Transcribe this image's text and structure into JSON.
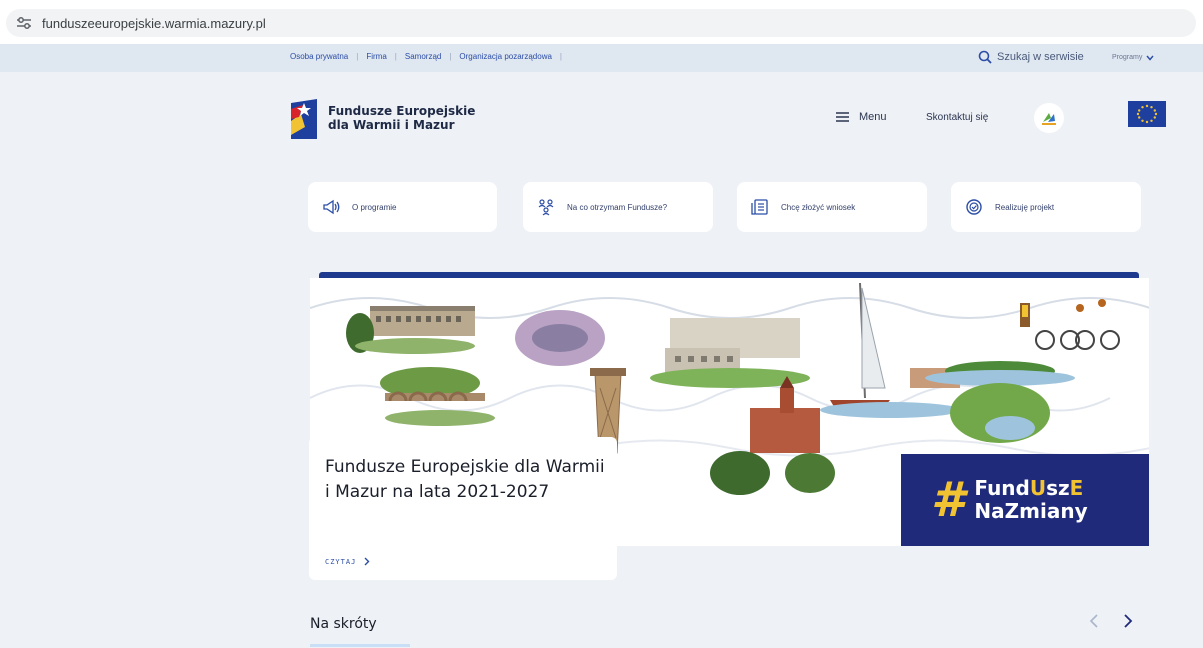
{
  "browser": {
    "url": "funduszeeuropejskie.warmia.mazury.pl"
  },
  "topbar": {
    "audience": [
      "Osoba prywatna",
      "Firma",
      "Samorząd",
      "Organizacja pozarządowa"
    ],
    "search_label": "Szukaj w serwisie",
    "programs_label": "Programy"
  },
  "header": {
    "logo_line1": "Fundusze Europejskie",
    "logo_line2": "dla Warmii i Mazur",
    "menu_label": "Menu",
    "contact_label": "Skontaktuj się"
  },
  "quick_links": [
    {
      "label": "O programie",
      "icon": "megaphone-icon"
    },
    {
      "label": "Na co otrzymam Fundusze?",
      "icon": "people-network-icon"
    },
    {
      "label": "Chcę złożyć wniosek",
      "icon": "document-list-icon"
    },
    {
      "label": "Realizuję projekt",
      "icon": "clock-check-icon"
    }
  ],
  "hero": {
    "title": "Fundusze Europejskie dla Warmii i Mazur na lata 2021-2027",
    "read_label": "CZYTAJ",
    "hashtag_line1_a": "Fund",
    "hashtag_line1_b": "U",
    "hashtag_line1_c": "sz",
    "hashtag_line1_d": "E",
    "hashtag_line2": "NaZmiany",
    "hashtag_sign": "#"
  },
  "section": {
    "title": "Na skróty"
  },
  "colors": {
    "accent": "#2b4da6",
    "navy": "#1f2a7a",
    "yellow": "#f1c232",
    "page_bg": "#eef1f6"
  }
}
